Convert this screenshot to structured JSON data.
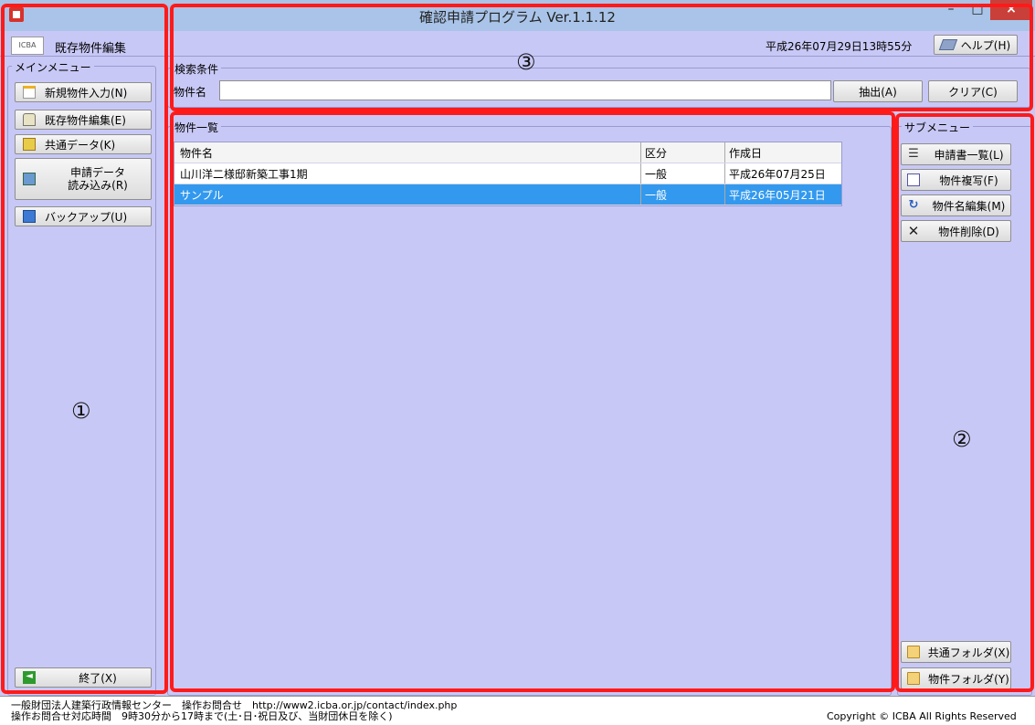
{
  "window": {
    "title": "確認申請プログラム Ver.1.1.12",
    "minimize": "–",
    "maximize": "□",
    "close": "×"
  },
  "header": {
    "logo_text": "ICBA",
    "screen_title": "既存物件編集",
    "datetime": "平成26年07月29日13時55分",
    "help_label": "ヘルプ(H)"
  },
  "main_menu": {
    "legend": "メインメニュー",
    "items": [
      {
        "label": "新規物件入力(N)",
        "icon": "new-document-icon"
      },
      {
        "label": "既存物件編集(E)",
        "icon": "house-icon"
      },
      {
        "label": "共通データ(K)",
        "icon": "pencil-icon"
      },
      {
        "label": "申請データ\n読み込み(R)",
        "icon": "import-icon"
      },
      {
        "label": "バックアップ(U)",
        "icon": "backup-icon"
      }
    ],
    "exit_label": "終了(X)"
  },
  "search": {
    "legend": "検索条件",
    "name_label": "物件名",
    "name_value": "",
    "extract_label": "抽出(A)",
    "clear_label": "クリア(C)"
  },
  "list": {
    "legend": "物件一覧",
    "columns": [
      "物件名",
      "区分",
      "作成日"
    ],
    "rows": [
      {
        "name": "山川洋二様邸新築工事1期",
        "type": "一般",
        "date": "平成26年07月25日",
        "selected": false
      },
      {
        "name": "サンプル",
        "type": "一般",
        "date": "平成26年05月21日",
        "selected": true
      }
    ]
  },
  "sub_menu": {
    "legend": "サブメニュー",
    "items": [
      {
        "label": "申請書一覧(L)",
        "icon": "list-icon"
      },
      {
        "label": "物件複写(F)",
        "icon": "copy-icon"
      },
      {
        "label": "物件名編集(M)",
        "icon": "refresh-icon"
      },
      {
        "label": "物件削除(D)",
        "icon": "delete-x-icon"
      }
    ],
    "common_folder_label": "共通フォルダ(X)",
    "property_folder_label": "物件フォルダ(Y)"
  },
  "annotations": {
    "n1": "①",
    "n2": "②",
    "n3": "③"
  },
  "footer": {
    "line1": "一般財団法人建築行政情報センター　操作お問合せ　http://www2.icba.or.jp/contact/index.php",
    "line2": "操作お問合せ対応時間　9時30分から17時まで(土･日･祝日及び、当財団休日を除く)",
    "copyright": "Copyright © ICBA All Rights Reserved"
  },
  "colors": {
    "background": "#c8c8f6",
    "selection": "#3399ee",
    "annotation_red": "#ff1a1a",
    "titlebar": "#a9c4e8"
  }
}
